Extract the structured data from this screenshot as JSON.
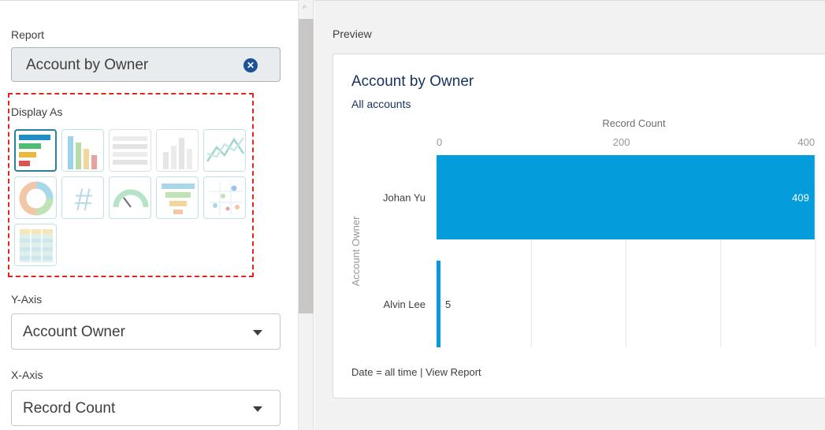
{
  "form": {
    "report_label": "Report",
    "report_value": "Account by Owner",
    "display_as_label": "Display As",
    "y_axis_label": "Y-Axis",
    "y_axis_value": "Account Owner",
    "x_axis_label": "X-Axis",
    "x_axis_value": "Record Count",
    "chart_types": [
      {
        "name": "horizontal-bar-chart-icon",
        "selected": true
      },
      {
        "name": "vertical-bar-chart-icon",
        "selected": false
      },
      {
        "name": "stacked-horizontal-bar-icon",
        "selected": false,
        "disabled": true
      },
      {
        "name": "stacked-vertical-bar-icon",
        "selected": false,
        "disabled": true
      },
      {
        "name": "line-chart-icon",
        "selected": false
      },
      {
        "name": "donut-chart-icon",
        "selected": false
      },
      {
        "name": "metric-icon",
        "selected": false
      },
      {
        "name": "gauge-chart-icon",
        "selected": false
      },
      {
        "name": "funnel-chart-icon",
        "selected": false
      },
      {
        "name": "scatter-chart-icon",
        "selected": false
      },
      {
        "name": "table-icon",
        "selected": false
      }
    ]
  },
  "preview": {
    "label": "Preview",
    "title": "Account by Owner",
    "subtitle": "All accounts",
    "footer_filter": "Date = all time",
    "footer_separator": " | ",
    "footer_link": "View Report"
  },
  "colors": {
    "bar": "#049cdb",
    "accent_dark": "#16325c"
  },
  "chart_data": {
    "type": "bar",
    "orientation": "horizontal",
    "xlabel": "Record Count",
    "ylabel": "Account Owner",
    "categories": [
      "Johan Yu",
      "Alvin Lee"
    ],
    "values": [
      409,
      5
    ],
    "data_labels": [
      "409",
      "5"
    ],
    "xticks": [
      0,
      200,
      400
    ],
    "xlim": [
      0,
      410
    ],
    "grid": true
  }
}
